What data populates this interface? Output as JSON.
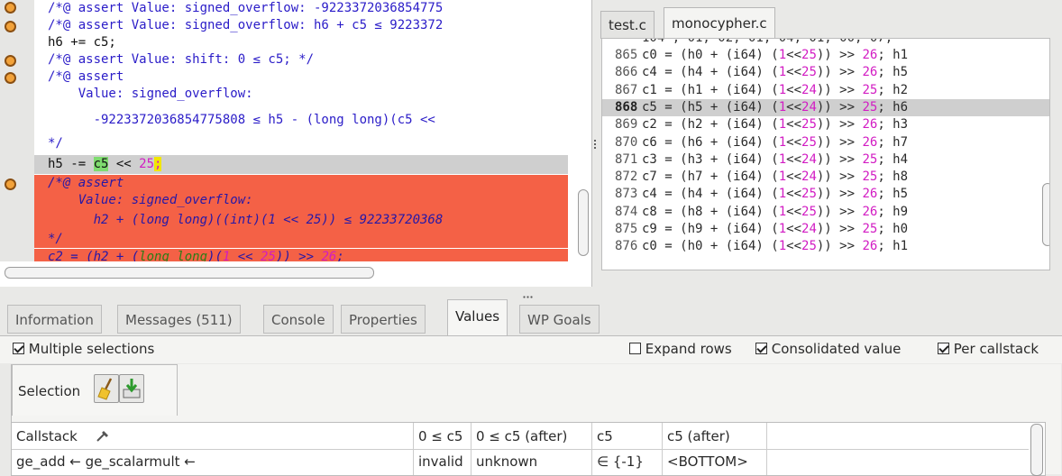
{
  "left_code": {
    "lines": [
      {
        "text": "/*@ assert Value: signed_overflow: -9223372036854775",
        "marker": true
      },
      {
        "text": "/*@ assert Value: signed_overflow: h6 + c5 ≤ 9223372",
        "marker": true
      },
      {
        "text": "h6 += c5;",
        "marker": false
      },
      {
        "text": "/*@ assert Value: shift: 0 ≤ c5; */",
        "marker": true
      },
      {
        "text": "/*@ assert",
        "marker": true
      },
      {
        "text": "    Value: signed_overflow:",
        "marker": false
      },
      {
        "text": "      -9223372036854775808 ≤ h5 - (long long)(c5 <<",
        "marker": false
      },
      {
        "text": "*/",
        "marker": false
      }
    ],
    "current_line": {
      "pre": "h5 -= ",
      "var": "c5",
      "mid": " << ",
      "num": "25",
      "end": ";"
    },
    "red_lines": [
      {
        "text": "/*@ assert",
        "marker": true
      },
      {
        "text": "    Value: signed_overflow:",
        "marker": false
      },
      {
        "text": "      h2 + (long long)((int)(1 << 25)) ≤ 92233720368",
        "marker": false
      },
      {
        "text": "*/",
        "marker": false
      }
    ],
    "red_last": {
      "pre": "c2 = (h2 + (",
      "kw": "long long",
      "a": ")(",
      "one": "1",
      "b": " << ",
      "n25": "25",
      "c": ")) >> ",
      "n26": "26",
      "end": ";"
    }
  },
  "file_tabs": [
    "test.c",
    "monocypher.c"
  ],
  "active_file_tab": "monocypher.c",
  "right_code": {
    "top_partial": "104 , 01, 02, 01, 04, 01, 00, 07,",
    "lines": [
      {
        "n": "865",
        "lhs": "c0 = (h0 + (i64) (",
        "one": "1",
        "sh": "<<",
        "k": "25",
        "r": ")) >> ",
        "s": "26",
        "tail": "; h1"
      },
      {
        "n": "866",
        "lhs": "c4 = (h4 + (i64) (",
        "one": "1",
        "sh": "<<",
        "k": "25",
        "r": ")) >> ",
        "s": "26",
        "tail": "; h5"
      },
      {
        "n": "867",
        "lhs": "c1 = (h1 + (i64) (",
        "one": "1",
        "sh": "<<",
        "k": "24",
        "r": ")) >> ",
        "s": "25",
        "tail": "; h2"
      },
      {
        "n": "868",
        "lhs": "c5 = (h5 + (i64) (",
        "one": "1",
        "sh": "<<",
        "k": "24",
        "r": ")) >> ",
        "s": "25",
        "tail": "; h6"
      },
      {
        "n": "869",
        "lhs": "c2 = (h2 + (i64) (",
        "one": "1",
        "sh": "<<",
        "k": "25",
        "r": ")) >> ",
        "s": "26",
        "tail": "; h3"
      },
      {
        "n": "870",
        "lhs": "c6 = (h6 + (i64) (",
        "one": "1",
        "sh": "<<",
        "k": "25",
        "r": ")) >> ",
        "s": "26",
        "tail": "; h7"
      },
      {
        "n": "871",
        "lhs": "c3 = (h3 + (i64) (",
        "one": "1",
        "sh": "<<",
        "k": "24",
        "r": ")) >> ",
        "s": "25",
        "tail": "; h4"
      },
      {
        "n": "872",
        "lhs": "c7 = (h7 + (i64) (",
        "one": "1",
        "sh": "<<",
        "k": "24",
        "r": ")) >> ",
        "s": "25",
        "tail": "; h8"
      },
      {
        "n": "873",
        "lhs": "c4 = (h4 + (i64) (",
        "one": "1",
        "sh": "<<",
        "k": "25",
        "r": ")) >> ",
        "s": "26",
        "tail": "; h5"
      },
      {
        "n": "874",
        "lhs": "c8 = (h8 + (i64) (",
        "one": "1",
        "sh": "<<",
        "k": "25",
        "r": ")) >> ",
        "s": "26",
        "tail": "; h9"
      },
      {
        "n": "875",
        "lhs": "c9 = (h9 + (i64) (",
        "one": "1",
        "sh": "<<",
        "k": "24",
        "r": ")) >> ",
        "s": "25",
        "tail": "; h0"
      },
      {
        "n": "876",
        "lhs": "c0 = (h0 + (i64) (",
        "one": "1",
        "sh": "<<",
        "k": "25",
        "r": ")) >> ",
        "s": "26",
        "tail": "; h1"
      }
    ],
    "current_line_number": "868"
  },
  "bottom_tabs": [
    "Information",
    "Messages (511)",
    "Console",
    "Properties",
    "Values",
    "WP Goals"
  ],
  "active_bottom_tab": "Values",
  "options": {
    "multiple_selections": {
      "label": "Multiple selections",
      "checked": true
    },
    "expand_rows": {
      "label": "Expand rows",
      "checked": false
    },
    "consolidated_value": {
      "label": "Consolidated value",
      "checked": true
    },
    "per_callstack": {
      "label": "Per callstack",
      "checked": true
    }
  },
  "selection": {
    "label": "Selection",
    "icons": [
      "broom-icon",
      "download-icon"
    ]
  },
  "table": {
    "headers": [
      "Callstack",
      "0 ≤ c5",
      "0 ≤ c5 (after)",
      "c5",
      "c5 (after)"
    ],
    "rows": [
      [
        "ge_add ← ge_scalarmult ←",
        "invalid",
        "unknown",
        "∈ {-1}",
        "<BOTTOM>"
      ]
    ]
  },
  "colors": {
    "red_highlight": "#f46146",
    "marker_orange": "#f2a23a",
    "comment_blue": "#2a1cc8",
    "number_magenta": "#d21cc3",
    "keyword_green": "#2b7d15"
  }
}
